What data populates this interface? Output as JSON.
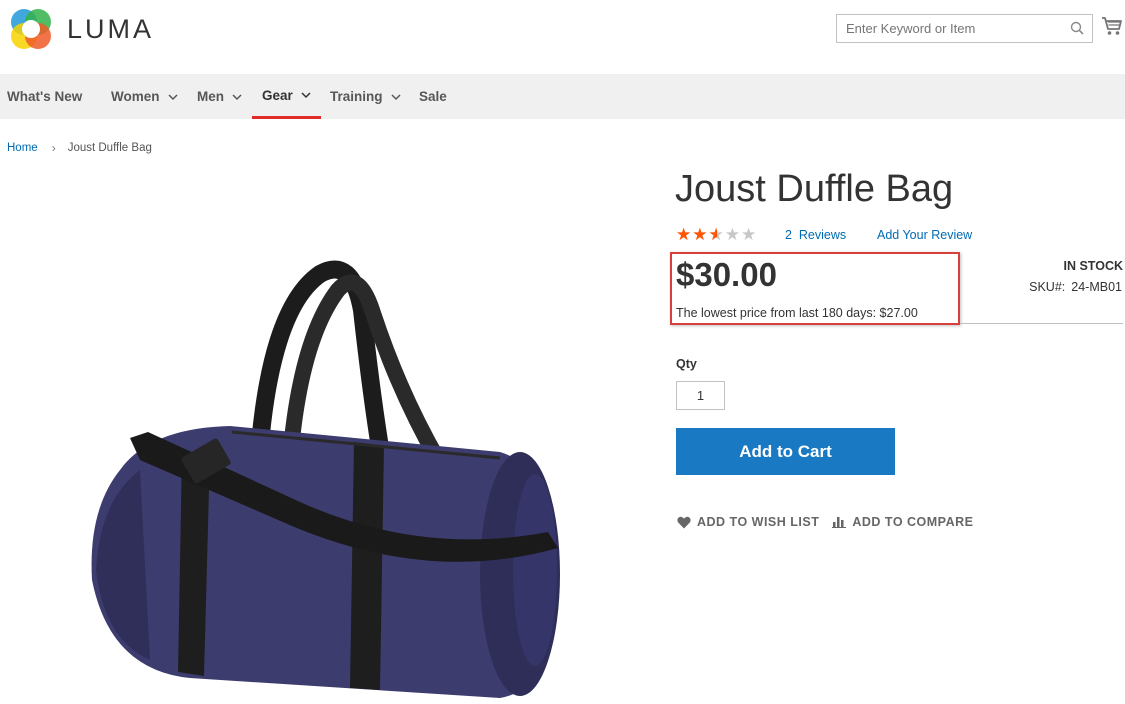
{
  "header": {
    "logo_text": "LUMA",
    "search": {
      "placeholder": "Enter Keyword or Item",
      "value": ""
    },
    "icons": {
      "search": "search-icon",
      "cart": "cart-icon"
    }
  },
  "nav": {
    "items": [
      {
        "label": "What's New",
        "has_dropdown": false,
        "active": false
      },
      {
        "label": "Women",
        "has_dropdown": true,
        "active": false
      },
      {
        "label": "Men",
        "has_dropdown": true,
        "active": false
      },
      {
        "label": "Gear",
        "has_dropdown": true,
        "active": true
      },
      {
        "label": "Training",
        "has_dropdown": true,
        "active": false
      },
      {
        "label": "Sale",
        "has_dropdown": false,
        "active": false
      }
    ]
  },
  "breadcrumb": {
    "home": "Home",
    "current": "Joust Duffle Bag"
  },
  "product": {
    "name": "Joust Duffle Bag",
    "rating_fraction": 0.5,
    "reviews_count": "2",
    "reviews_label": "Reviews",
    "add_review_label": "Add Your Review",
    "price": "$30.00",
    "lowest_price_text": "The lowest price from last 180 days: $27.00",
    "stock": "In stock",
    "sku_label": "SKU#:",
    "sku": "24-MB01",
    "qty_label": "Qty",
    "qty_value": "1",
    "add_to_cart_label": "Add to Cart",
    "wishlist_label": "ADD TO WISH LIST",
    "compare_label": "ADD TO COMPARE"
  },
  "colors": {
    "accent_blue": "#1979c3",
    "link_blue": "#006bb4",
    "star_orange": "#ff5501",
    "nav_active_red": "#e02b27",
    "highlight_box_red": "#d8403e",
    "bag_purple": "#3d3c6e"
  }
}
